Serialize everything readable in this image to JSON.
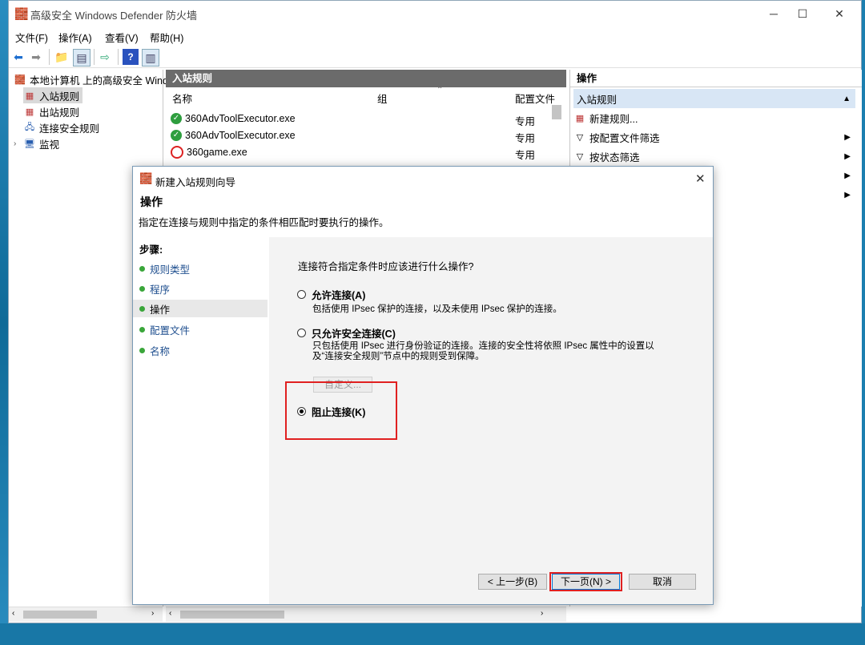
{
  "window": {
    "title": "高级安全 Windows Defender 防火墙"
  },
  "menu": [
    "文件(F)",
    "操作(A)",
    "查看(V)",
    "帮助(H)"
  ],
  "tree": {
    "root": "本地计算机 上的高级安全 Windows",
    "items": [
      "入站规则",
      "出站规则",
      "连接安全规则",
      "监视"
    ]
  },
  "middle": {
    "header": "入站规则",
    "columns": {
      "name": "名称",
      "group": "组",
      "profile": "配置文件"
    },
    "rows": [
      {
        "name": "360AdvToolExecutor.exe",
        "profile": "专用",
        "status": "allow"
      },
      {
        "name": "360AdvToolExecutor.exe",
        "profile": "专用",
        "status": "allow"
      },
      {
        "name": "360game.exe",
        "profile": "专用",
        "status": "block"
      }
    ]
  },
  "actions": {
    "header": "操作",
    "section": "入站规则",
    "items": [
      "新建规则...",
      "按配置文件筛选",
      "按状态筛选"
    ]
  },
  "dialog": {
    "title": "新建入站规则向导",
    "heading": "操作",
    "subheading": "指定在连接与规则中指定的条件相匹配时要执行的操作。",
    "steps_label": "步骤:",
    "steps": [
      "规则类型",
      "程序",
      "操作",
      "配置文件",
      "名称"
    ],
    "question": "连接符合指定条件时应该进行什么操作?",
    "options": [
      {
        "label": "允许连接(A)",
        "desc": "包括使用 IPsec 保护的连接，以及未使用 IPsec 保护的连接。",
        "selected": false
      },
      {
        "label": "只允许安全连接(C)",
        "desc": "只包括使用 IPsec 进行身份验证的连接。连接的安全性将依照 IPsec 属性中的设置以及“连接安全规则”节点中的规则受到保障。",
        "selected": false
      },
      {
        "label": "阻止连接(K)",
        "desc": "",
        "selected": true
      }
    ],
    "customize_label": "自定义...",
    "buttons": {
      "back": "< 上一步(B)",
      "next": "下一页(N) >",
      "cancel": "取消"
    }
  }
}
